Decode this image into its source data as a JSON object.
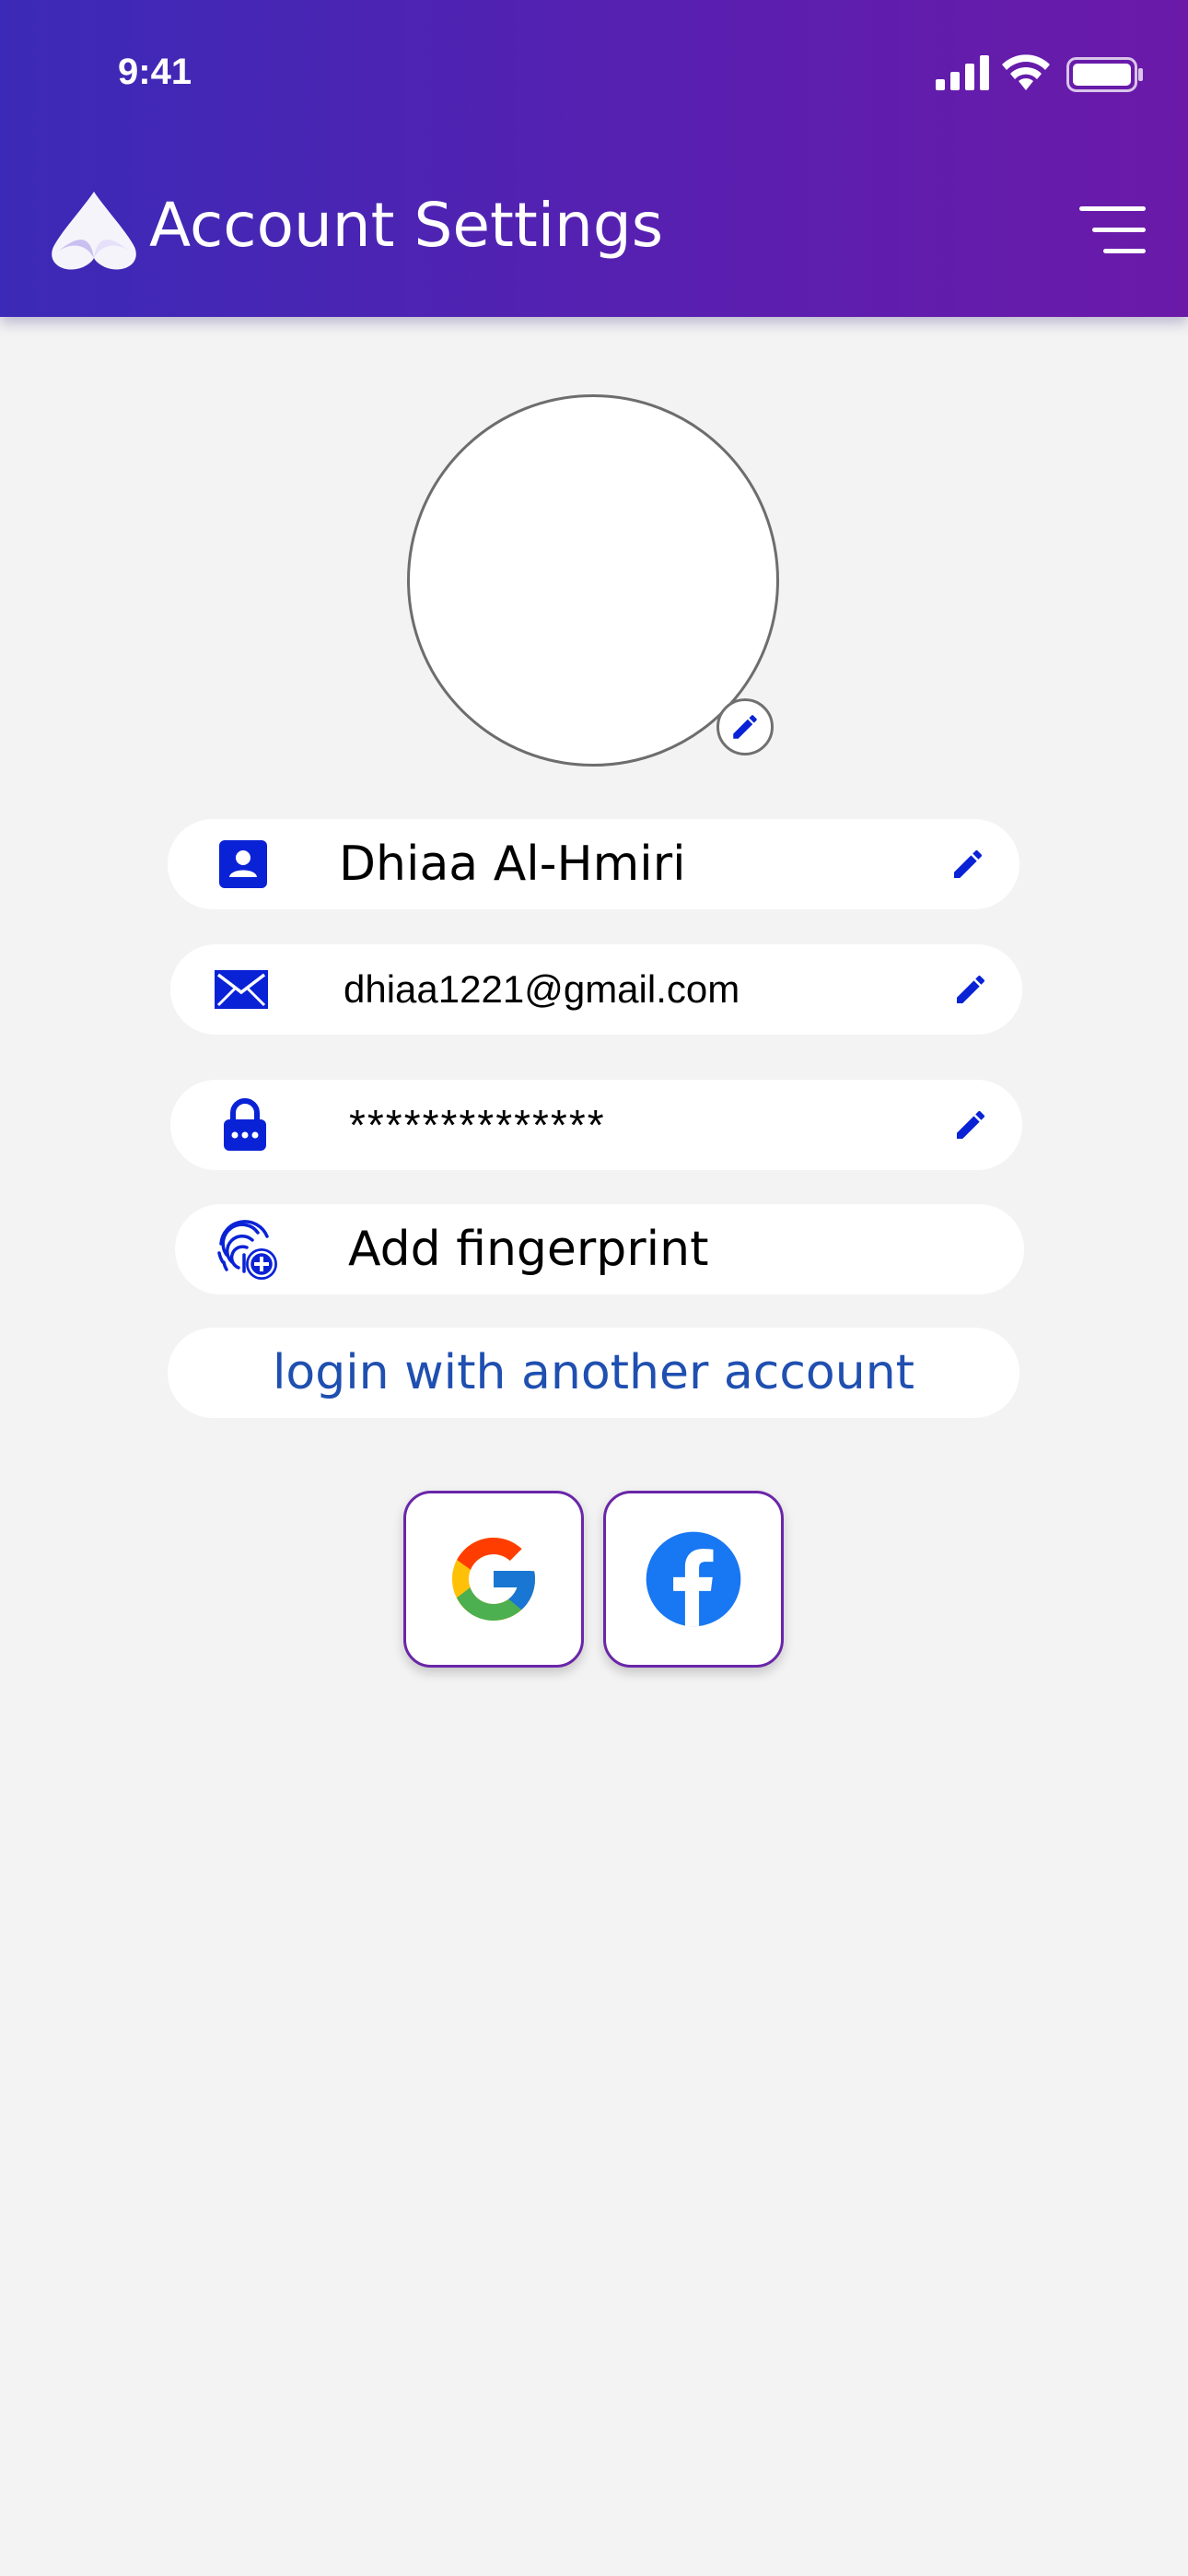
{
  "status_bar": {
    "time": "9:41"
  },
  "header": {
    "title": "Account Settings",
    "logo_icon": "app-logo-icon",
    "menu_icon": "hamburger-menu-icon",
    "gradient_start": "#3b2ab7",
    "gradient_end": "#6b1aa8"
  },
  "profile": {
    "avatar_edit_icon": "pencil-icon"
  },
  "fields": {
    "name": {
      "value": "Dhiaa Al-Hmiri",
      "icon": "contact-card-icon",
      "edit_icon": "pencil-icon"
    },
    "email": {
      "value": "dhiaa1221@gmail.com",
      "icon": "envelope-icon",
      "edit_icon": "pencil-icon"
    },
    "password": {
      "value": "**************",
      "icon": "lock-icon",
      "edit_icon": "pencil-icon"
    },
    "fingerprint": {
      "label": "Add fingerprint",
      "icon": "fingerprint-add-icon"
    }
  },
  "login_other": {
    "label": "login with another account"
  },
  "social_logins": [
    {
      "name": "google",
      "icon": "google-icon"
    },
    {
      "name": "facebook",
      "icon": "facebook-icon"
    }
  ],
  "colors": {
    "accent_blue": "#0a22d6",
    "link_blue": "#1f4fb0",
    "background": "#f3f3f3",
    "social_border": "#6a26a8",
    "facebook_blue": "#1877f2"
  }
}
